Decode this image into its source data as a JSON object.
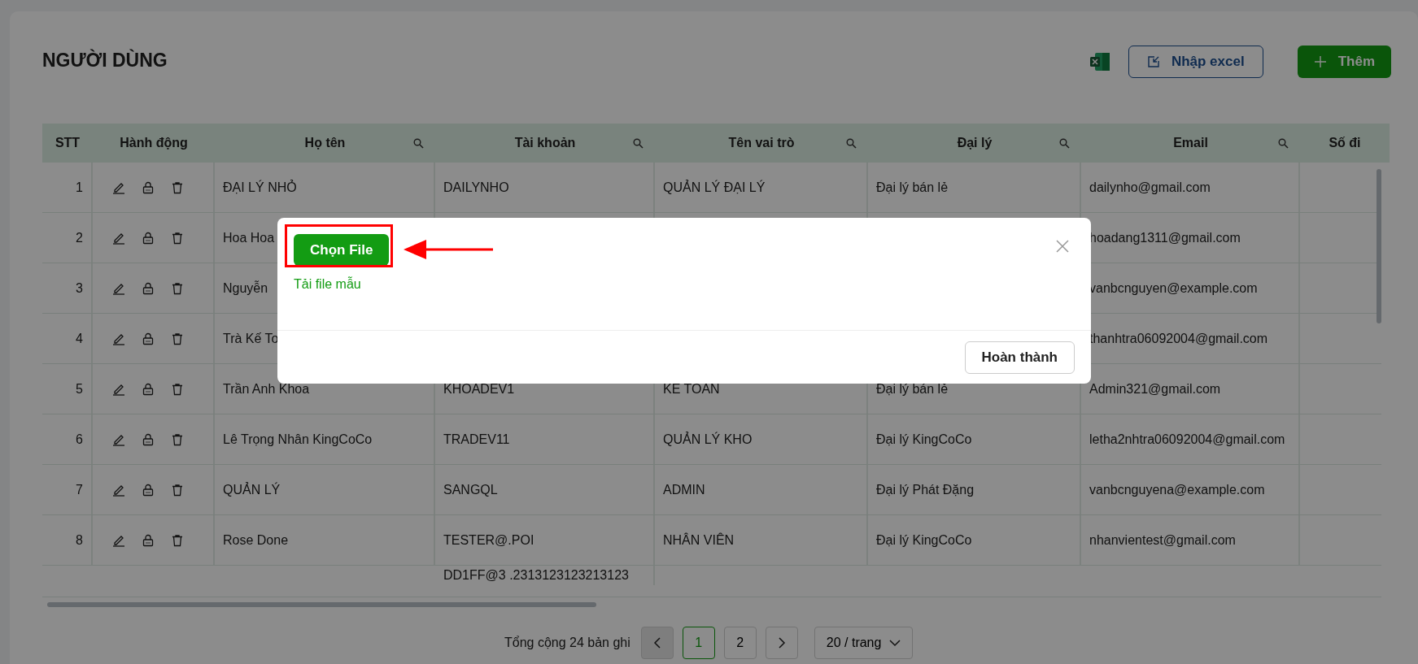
{
  "page": {
    "title": "NGƯỜI DÙNG"
  },
  "toolbar": {
    "import_button": "Nhập excel",
    "add_button": "Thêm"
  },
  "table": {
    "columns": [
      {
        "label": "STT",
        "searchable": false
      },
      {
        "label": "Hành động",
        "searchable": false
      },
      {
        "label": "Họ tên",
        "searchable": true
      },
      {
        "label": "Tài khoản",
        "searchable": true
      },
      {
        "label": "Tên vai trò",
        "searchable": true
      },
      {
        "label": "Đại lý",
        "searchable": true
      },
      {
        "label": "Email",
        "searchable": true
      },
      {
        "label": "Số đi",
        "searchable": false
      }
    ],
    "rows": [
      {
        "clipped": false,
        "cells": [
          "1",
          "",
          "ĐẠI LÝ NHỎ",
          "DAILYNHO",
          "QUẢN LÝ ĐẠI LÝ",
          "Đại lý bán lẻ",
          "dailynho@gmail.com",
          ""
        ]
      },
      {
        "clipped": false,
        "cells": [
          "2",
          "",
          "Hoa Hoa",
          "",
          "",
          "",
          "hoadang1311@gmail.com",
          ""
        ]
      },
      {
        "clipped": false,
        "cells": [
          "3",
          "",
          "Nguyễn",
          "",
          "",
          "",
          "vanbcnguyen@example.com",
          ""
        ]
      },
      {
        "clipped": false,
        "cells": [
          "4",
          "",
          "Trà Kế To",
          "",
          "",
          "",
          "thanhtra06092004@gmail.com",
          ""
        ]
      },
      {
        "clipped": false,
        "cells": [
          "5",
          "",
          "Trần Anh Khoa",
          "KHOADEV1",
          "KẾ TOÁN",
          "Đại lý bán lẻ",
          "Admin321@gmail.com",
          ""
        ]
      },
      {
        "clipped": false,
        "cells": [
          "6",
          "",
          "Lê Trọng Nhân KingCoCo",
          "TRADEV11",
          "QUẢN LÝ KHO",
          "Đại lý KingCoCo",
          "letha2nhtra06092004@gmail.com",
          ""
        ]
      },
      {
        "clipped": false,
        "cells": [
          "7",
          "",
          "QUẢN LÝ",
          "SANGQL",
          "ADMIN",
          "Đại lý Phát Đặng",
          "vanbcnguyena@example.com",
          ""
        ]
      },
      {
        "clipped": false,
        "cells": [
          "8",
          "",
          "Rose Done",
          "TESTER@.POI",
          "NHÂN VIÊN",
          "Đại lý KingCoCo",
          "nhanvientest@gmail.com",
          ""
        ]
      },
      {
        "clipped": true,
        "cells": [
          "",
          "",
          "",
          "DD1FF@3 .2313123123213123",
          "",
          "",
          "",
          ""
        ]
      }
    ]
  },
  "pagination": {
    "total": "Tổng cộng 24 bản ghi",
    "prev_disabled": true,
    "pages": [
      {
        "label": "1",
        "selected": true
      },
      {
        "label": "2",
        "selected": false
      }
    ],
    "page_size": "20 / trang"
  },
  "modal": {
    "choose_button": "Chọn File",
    "template_link": "Tải file mẫu",
    "done_button": "Hoàn thành"
  }
}
